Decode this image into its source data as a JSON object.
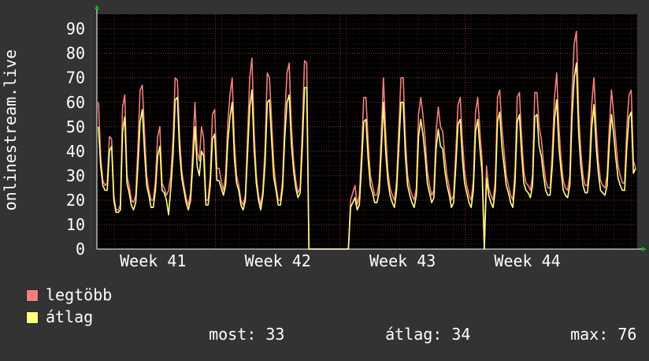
{
  "chart_data": {
    "type": "line",
    "ylabel": "onlinestream.live",
    "ylim": [
      0,
      96
    ],
    "yticks": [
      0,
      10,
      20,
      30,
      40,
      50,
      60,
      70,
      80,
      90
    ],
    "x_tick_labels": [
      {
        "label": "Week 41",
        "week_pos": 1.0
      },
      {
        "label": "Week 42",
        "week_pos": 2.0
      },
      {
        "label": "Week 43",
        "week_pos": 3.0
      },
      {
        "label": "Week 44",
        "week_pos": 4.0
      }
    ],
    "x_range_weeks": [
      0.55,
      4.88
    ],
    "series": [
      {
        "name": "legtöbb",
        "color": "#f47d7d",
        "values": [
          60,
          38,
          28,
          26,
          27,
          46,
          45,
          22,
          16,
          16,
          18,
          58,
          63,
          30,
          26,
          20,
          19,
          22,
          42,
          65,
          67,
          48,
          30,
          24,
          20,
          20,
          28,
          46,
          50,
          27,
          25,
          22,
          24,
          30,
          45,
          70,
          69,
          46,
          32,
          26,
          21,
          18,
          23,
          40,
          60,
          40,
          36,
          50,
          45,
          20,
          20,
          30,
          55,
          57,
          33,
          33,
          28,
          24,
          30,
          52,
          63,
          70,
          44,
          30,
          26,
          20,
          18,
          22,
          46,
          70,
          78,
          48,
          30,
          22,
          18,
          24,
          42,
          72,
          70,
          52,
          34,
          26,
          20,
          20,
          28,
          54,
          72,
          76,
          50,
          36,
          28,
          23,
          25,
          50,
          77,
          76,
          0,
          0,
          0,
          0,
          0,
          0,
          0,
          0,
          0,
          0,
          0,
          0,
          0,
          0,
          0,
          0,
          0,
          0,
          0,
          20,
          23,
          26,
          18,
          22,
          40,
          62,
          62,
          44,
          30,
          26,
          22,
          22,
          27,
          47,
          70,
          48,
          32,
          25,
          22,
          20,
          28,
          50,
          70,
          70,
          45,
          30,
          25,
          22,
          20,
          25,
          55,
          62,
          55,
          45,
          32,
          26,
          22,
          24,
          48,
          58,
          50,
          48,
          38,
          30,
          25,
          20,
          22,
          40,
          59,
          62,
          44,
          32,
          26,
          22,
          20,
          28,
          56,
          62,
          48,
          36,
          0,
          34,
          25,
          22,
          20,
          28,
          62,
          65,
          50,
          40,
          30,
          26,
          22,
          20,
          32,
          62,
          64,
          46,
          32,
          27,
          26,
          24,
          30,
          64,
          64,
          50,
          45,
          35,
          28,
          25,
          25,
          40,
          62,
          72,
          50,
          37,
          28,
          25,
          24,
          30,
          64,
          84,
          89,
          56,
          40,
          30,
          26,
          26,
          36,
          59,
          70,
          50,
          36,
          28,
          26,
          25,
          30,
          50,
          65,
          55,
          44,
          34,
          30,
          27,
          27,
          50,
          63,
          65,
          36,
          33
        ]
      },
      {
        "name": "átlag",
        "color": "#ffff80",
        "values": [
          50,
          34,
          26,
          24,
          24,
          40,
          42,
          20,
          15,
          15,
          16,
          48,
          54,
          27,
          23,
          18,
          16,
          19,
          34,
          52,
          57,
          40,
          26,
          22,
          17,
          17,
          24,
          38,
          42,
          24,
          23,
          20,
          14,
          25,
          38,
          61,
          62,
          40,
          29,
          24,
          19,
          16,
          20,
          34,
          50,
          34,
          30,
          40,
          38,
          18,
          18,
          26,
          45,
          47,
          28,
          28,
          25,
          22,
          26,
          44,
          54,
          60,
          37,
          27,
          24,
          18,
          16,
          20,
          39,
          58,
          65,
          41,
          27,
          20,
          16,
          22,
          35,
          60,
          61,
          44,
          29,
          24,
          18,
          18,
          25,
          46,
          60,
          63,
          43,
          32,
          25,
          21,
          23,
          42,
          66,
          66,
          0,
          0,
          0,
          0,
          0,
          0,
          0,
          0,
          0,
          0,
          0,
          0,
          0,
          0,
          0,
          0,
          0,
          0,
          0,
          17,
          19,
          21,
          16,
          18,
          34,
          52,
          53,
          37,
          26,
          23,
          19,
          19,
          23,
          40,
          60,
          40,
          28,
          22,
          19,
          17,
          24,
          42,
          60,
          60,
          38,
          26,
          22,
          19,
          17,
          22,
          46,
          53,
          47,
          38,
          27,
          23,
          19,
          21,
          41,
          49,
          42,
          41,
          32,
          26,
          22,
          17,
          19,
          34,
          51,
          53,
          37,
          27,
          23,
          19,
          17,
          24,
          48,
          53,
          41,
          31,
          0,
          29,
          22,
          19,
          17,
          24,
          52,
          56,
          42,
          34,
          26,
          23,
          19,
          17,
          27,
          52,
          55,
          39,
          27,
          24,
          23,
          21,
          26,
          54,
          55,
          42,
          38,
          30,
          24,
          22,
          22,
          34,
          53,
          61,
          42,
          32,
          24,
          22,
          21,
          26,
          54,
          70,
          76,
          48,
          34,
          26,
          23,
          23,
          31,
          50,
          59,
          42,
          31,
          24,
          23,
          22,
          26,
          43,
          55,
          47,
          37,
          29,
          26,
          24,
          24,
          42,
          54,
          56,
          31,
          33
        ]
      }
    ],
    "legend": [
      {
        "label": "legtöbb",
        "color": "#f47d7d"
      },
      {
        "label": "átlag",
        "color": "#ffff80"
      }
    ],
    "stats": {
      "now_label": "most:",
      "now_value": "33",
      "avg_label": "átlag:",
      "avg_value": "34",
      "max_label": "max:",
      "max_value": "76"
    },
    "grid": true
  }
}
